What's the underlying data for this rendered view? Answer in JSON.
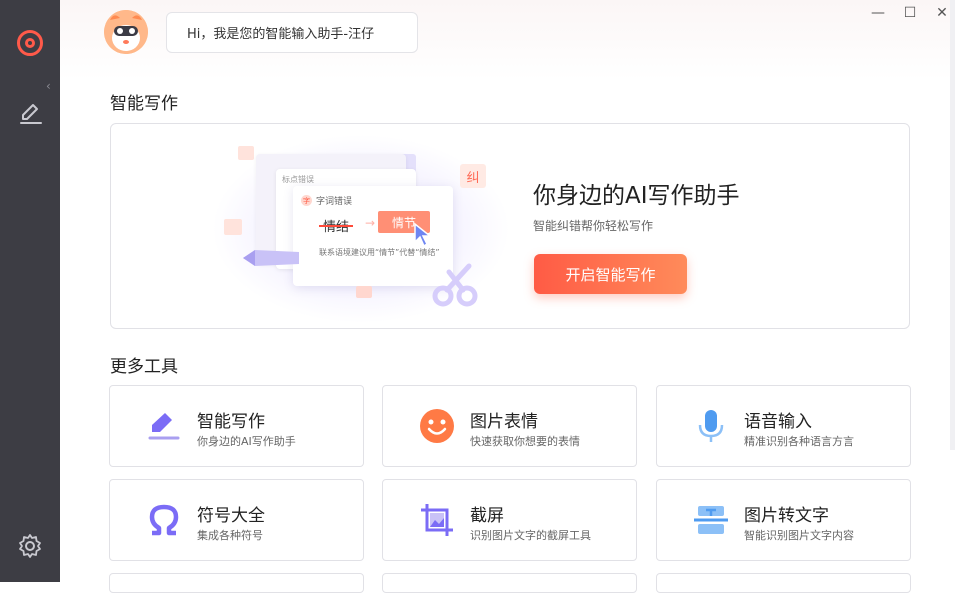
{
  "sidebar": {
    "logo_icon": "app-logo-icon",
    "collapse_glyph": "‹",
    "items": [
      {
        "icon": "pen-write-icon"
      }
    ],
    "settings_icon": "gear-icon"
  },
  "header": {
    "greeting": "Hi，我是您的智能输入助手-汪仔"
  },
  "window_controls": {
    "minimize": "—",
    "maximize": "☐",
    "close": "✕"
  },
  "smart_writing": {
    "section_title": "智能写作",
    "hero_title": "你身边的AI写作助手",
    "hero_subtitle": "智能纠错帮你轻松写作",
    "hero_button": "开启智能写作",
    "illustration": {
      "back_card_label": "标点错误",
      "card_head": "字词错误",
      "card_head_badge": "字",
      "wrong_word": "情结",
      "correct_word": "情节",
      "arrow": "→",
      "note": "联系语境建议用“情节”代替“情结”",
      "corner_char": "纠"
    }
  },
  "more_tools": {
    "section_title": "更多工具",
    "tools": [
      {
        "title": "智能写作",
        "desc": "你身边的AI写作助手",
        "icon": "pen-write-icon"
      },
      {
        "title": "图片表情",
        "desc": "快速获取你想要的表情",
        "icon": "smiley-icon"
      },
      {
        "title": "语音输入",
        "desc": "精准识别各种语言方言",
        "icon": "microphone-icon"
      },
      {
        "title": "符号大全",
        "desc": "集成各种符号",
        "icon": "omega-icon"
      },
      {
        "title": "截屏",
        "desc": "识别图片文字的截屏工具",
        "icon": "screenshot-icon"
      },
      {
        "title": "图片转文字",
        "desc": "智能识别图片文字内容",
        "icon": "image-to-text-icon"
      }
    ]
  },
  "colors": {
    "sidebar_bg": "#3d3d44",
    "accent": "#ff5b45",
    "purple": "#7b6cf6",
    "blue": "#4f9bf0"
  }
}
